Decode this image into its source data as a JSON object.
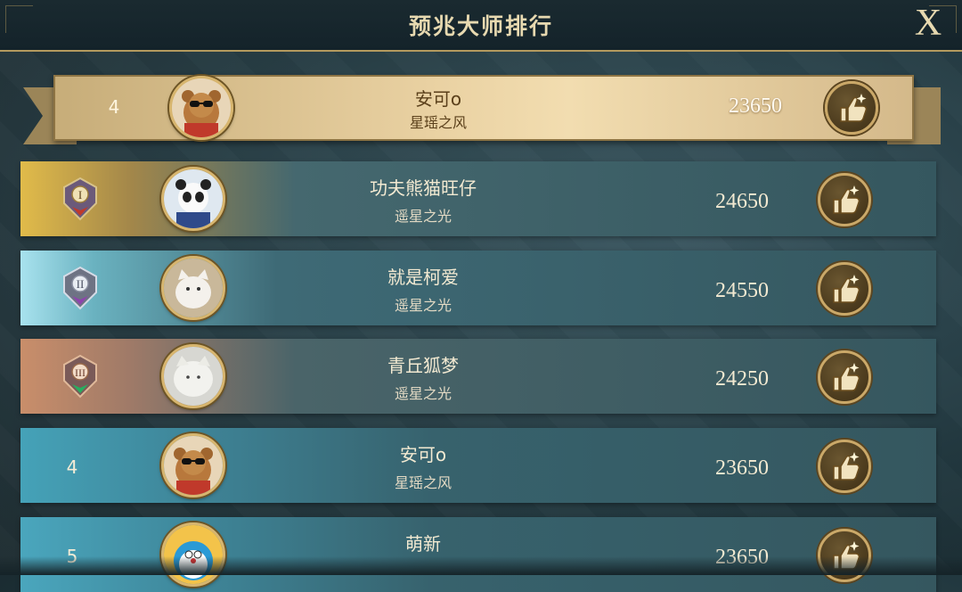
{
  "header": {
    "title": "预兆大师排行",
    "close_label": "X"
  },
  "self": {
    "rank": "4",
    "name": "安可o",
    "server": "星瑶之风",
    "score": "23650",
    "avatar": "bear-sunglasses-avatar",
    "like_icon": "thumbs-up-icon"
  },
  "rows": [
    {
      "rank": "",
      "badge": "rank-1-badge",
      "name": "功夫熊猫旺仔",
      "server": "遥星之光",
      "score": "24650",
      "avatar": "panda-avatar"
    },
    {
      "rank": "",
      "badge": "rank-2-badge",
      "name": "就是柯爱",
      "server": "遥星之光",
      "score": "24550",
      "avatar": "cat-avatar"
    },
    {
      "rank": "",
      "badge": "rank-3-badge",
      "name": "青丘狐梦",
      "server": "遥星之光",
      "score": "24250",
      "avatar": "fox-avatar"
    },
    {
      "rank": "4",
      "badge": "",
      "name": "安可o",
      "server": "星瑶之风",
      "score": "23650",
      "avatar": "bear-sunglasses-avatar"
    },
    {
      "rank": "5",
      "badge": "",
      "name": "萌新",
      "server": "",
      "score": "23650",
      "avatar": "doraemon-avatar"
    }
  ],
  "colors": {
    "gold": "#d7b56e",
    "row_teal": "#35575f",
    "self_gold": "#ead2a3"
  }
}
